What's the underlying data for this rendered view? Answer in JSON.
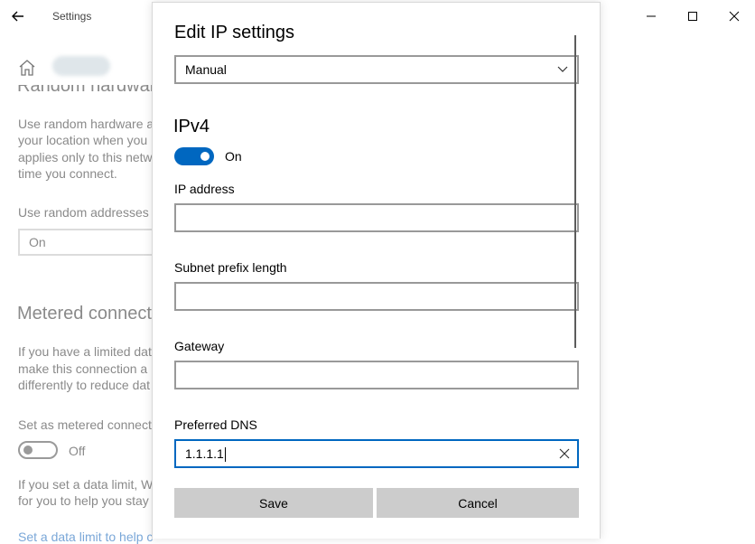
{
  "window": {
    "title": "Settings"
  },
  "background": {
    "random_hw_heading": "Random hardware addresses",
    "random_hw_desc": [
      "Use random hardware a",
      "your location when you",
      "applies only to this netw",
      "time you connect."
    ],
    "random_addresses_label": "Use random addresses f",
    "random_addresses_value": "On",
    "metered_heading": "Metered connect",
    "metered_desc": [
      "If you have a limited dat",
      "make this connection a",
      "differently to reduce dat"
    ],
    "metered_label": "Set as metered connecti",
    "metered_toggle_text": "Off",
    "data_limit_desc": [
      "If you set a data limit, W",
      "for you to help you stay"
    ],
    "data_limit_link": "Set a data limit to help c"
  },
  "dialog": {
    "title": "Edit IP settings",
    "mode_value": "Manual",
    "section_title": "IPv4",
    "ipv4_toggle_text": "On",
    "fields": [
      {
        "label": "IP address",
        "value": ""
      },
      {
        "label": "Subnet prefix length",
        "value": ""
      },
      {
        "label": "Gateway",
        "value": ""
      },
      {
        "label": "Preferred DNS",
        "value": "1.1.1.1"
      }
    ],
    "save_label": "Save",
    "cancel_label": "Cancel"
  },
  "colors": {
    "accent": "#0067c0",
    "button_bg": "#cccccc"
  }
}
